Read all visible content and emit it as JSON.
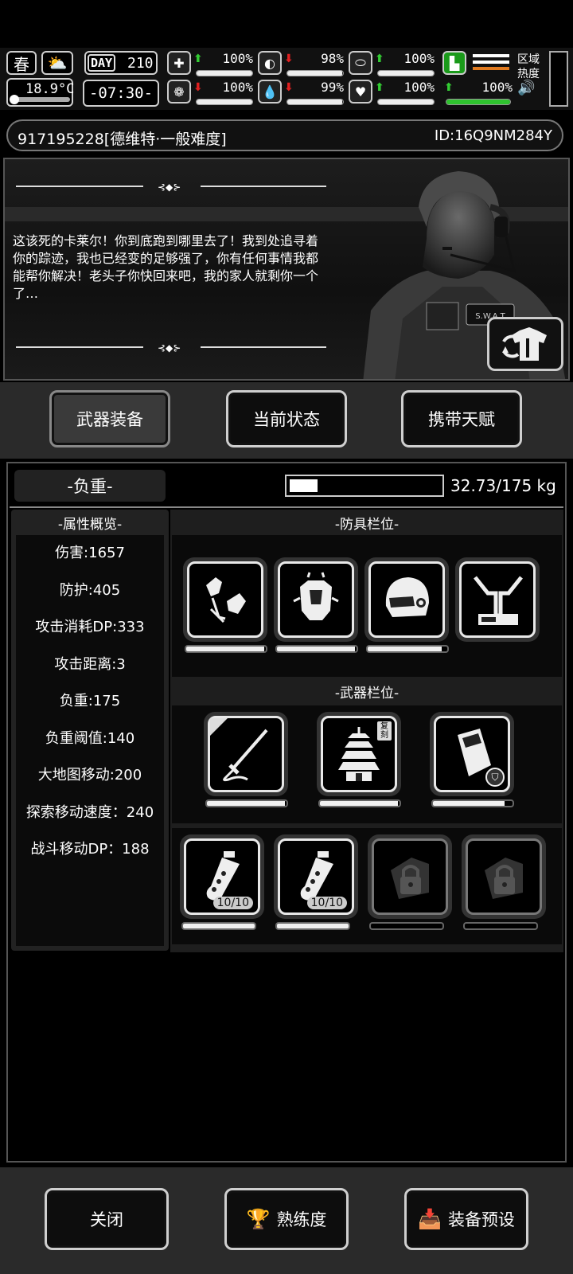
{
  "hud": {
    "season": "春",
    "weather_icon": "partly-cloudy-icon",
    "temperature": "18.9°C",
    "day_label": "DAY",
    "day": "210",
    "clock": "-07:30-",
    "stats": [
      {
        "name": "health",
        "icon": "medkit-icon",
        "trend": "up",
        "value": "100%",
        "fraction": 1.0
      },
      {
        "name": "hunger",
        "icon": "stomach-icon",
        "trend": "down",
        "value": "98%",
        "fraction": 0.98
      },
      {
        "name": "medicine",
        "icon": "pill-icon",
        "trend": "up",
        "value": "100%",
        "fraction": 1.0
      },
      {
        "name": "sanity",
        "icon": "brain-icon",
        "trend": "down",
        "value": "100%",
        "fraction": 1.0
      },
      {
        "name": "thirst",
        "icon": "water-drop-icon",
        "trend": "down",
        "value": "99%",
        "fraction": 0.99
      },
      {
        "name": "heart",
        "icon": "heart-icon",
        "trend": "up",
        "value": "100%",
        "fraction": 1.0
      },
      {
        "name": "stamina",
        "icon": "boot-icon",
        "trend": "up",
        "value": "100%",
        "fraction": 1.0
      }
    ],
    "region_heat_label": "区域\n热度"
  },
  "character": {
    "name": "917195228[德维特·一般难度]",
    "uid": "ID:16Q9NM284Y",
    "dialogue": "这该死的卡莱尔！你到底跑到哪里去了！我到处追寻着你的踪迹，我也已经变的足够强了，你有任何事情我都能帮你解决！老头子你快回来吧，我的家人就剩你一个了…",
    "badge_text": "S.W.A.T"
  },
  "tabs": [
    {
      "label": "武器装备",
      "active": true
    },
    {
      "label": "当前状态",
      "active": false
    },
    {
      "label": "携带天赋",
      "active": false
    }
  ],
  "load": {
    "label": "-负重-",
    "current": 32.73,
    "max": 175,
    "text": "32.73/175 kg"
  },
  "attributes": {
    "header": "-属性概览-",
    "items": [
      "伤害:1657",
      "防护:405",
      "攻击消耗DP:333",
      "攻击距离:3",
      "负重:175",
      "负重阈值:140",
      "大地图移动:200",
      "探索移动速度：240",
      "战斗移动DP：188"
    ]
  },
  "armor": {
    "header": "-防具栏位-",
    "slots": [
      {
        "icon": "shoulder-armor-icon",
        "durability": 0.98
      },
      {
        "icon": "chest-armor-icon",
        "durability": 0.98
      },
      {
        "icon": "helmet-icon",
        "durability": 0.93
      },
      {
        "icon": "leg-armor-icon",
        "durability": null
      }
    ]
  },
  "weapons": {
    "header": "-武器栏位-",
    "slots": [
      {
        "icon": "katana-icon",
        "durability": 0.98
      },
      {
        "icon": "pagoda-icon",
        "tag": "复刻",
        "durability": 0.98
      },
      {
        "icon": "riot-shield-icon",
        "durability": 0.9
      }
    ]
  },
  "consumables": {
    "slots": [
      {
        "icon": "grenade-icon",
        "count": "10/10",
        "locked": false,
        "durability": 1.0
      },
      {
        "icon": "grenade-icon",
        "count": "10/10",
        "locked": false,
        "durability": 1.0
      },
      {
        "icon": "lock-icon",
        "locked": true,
        "durability": 0
      },
      {
        "icon": "lock-icon",
        "locked": true,
        "durability": 0
      }
    ]
  },
  "footer": {
    "close": "关闭",
    "proficiency": "熟练度",
    "preset": "装备预设"
  }
}
